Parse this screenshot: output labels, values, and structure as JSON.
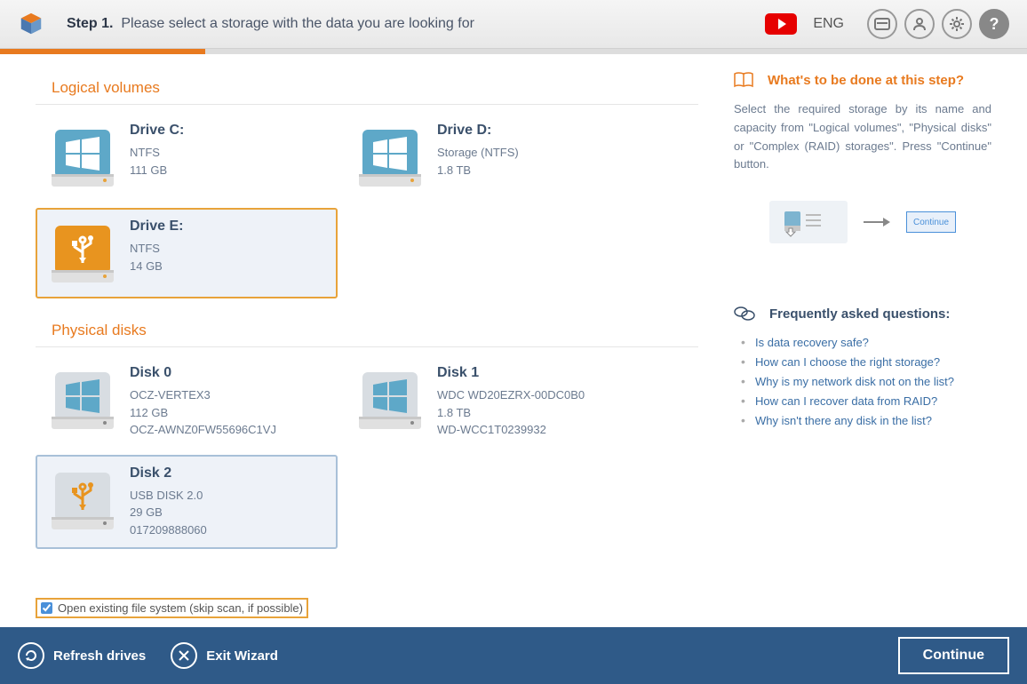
{
  "header": {
    "step_prefix": "Step 1.",
    "step_text": "Please select a storage with the data you are looking for",
    "lang": "ENG"
  },
  "sections": {
    "logical": "Logical volumes",
    "physical": "Physical disks"
  },
  "logical": [
    {
      "title": "Drive C:",
      "fs": "NTFS",
      "size": "111 GB",
      "usb": false
    },
    {
      "title": "Drive D:",
      "fs": "Storage (NTFS)",
      "size": "1.8 TB",
      "usb": false
    },
    {
      "title": "Drive E:",
      "fs": "NTFS",
      "size": "14 GB",
      "usb": true,
      "selected": true
    }
  ],
  "physical": [
    {
      "title": "Disk 0",
      "l1": "OCZ-VERTEX3",
      "l2": "112 GB",
      "l3": "OCZ-AWNZ0FW55696C1VJ",
      "usb": false
    },
    {
      "title": "Disk 1",
      "l1": "WDC WD20EZRX-00DC0B0",
      "l2": "1.8 TB",
      "l3": "WD-WCC1T0239932",
      "usb": false
    },
    {
      "title": "Disk 2",
      "l1": "USB DISK 2.0",
      "l2": "29 GB",
      "l3": "017209888060",
      "usb": true,
      "hover": true
    }
  ],
  "checkbox": {
    "label": "Open existing file system (skip scan, if possible)"
  },
  "help": {
    "title": "What's to be done at this step?",
    "text": "Select the required storage by its name and capacity from \"Logical volumes\", \"Physical disks\" or \"Complex (RAID) storages\". Press \"Continue\" button.",
    "mini_btn": "Continue"
  },
  "faq": {
    "title": "Frequently asked questions:",
    "items": [
      "Is data recovery safe?",
      "How can I choose the right storage?",
      "Why is my network disk not on the list?",
      "How can I recover data from RAID?",
      "Why isn't there any disk in the list?"
    ]
  },
  "footer": {
    "refresh": "Refresh drives",
    "exit": "Exit Wizard",
    "continue": "Continue"
  }
}
